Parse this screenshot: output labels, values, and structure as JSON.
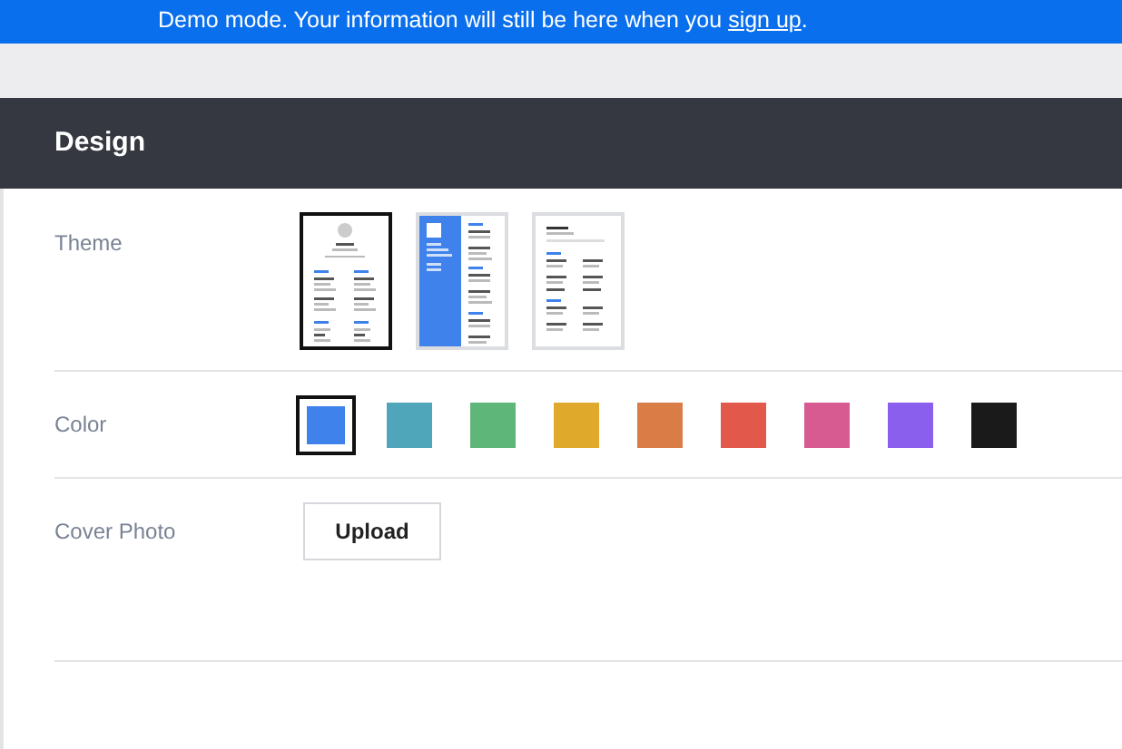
{
  "banner": {
    "message": "Demo mode. Your information will still be here when you",
    "link": "sign up",
    "end": "."
  },
  "section": {
    "title": "Design"
  },
  "theme": {
    "label": "Theme",
    "options": [
      {
        "kind": "centered",
        "selected": true
      },
      {
        "kind": "sidebar",
        "selected": false
      },
      {
        "kind": "classic",
        "selected": false
      }
    ]
  },
  "color": {
    "label": "Color",
    "swatches": [
      {
        "color": "#3f82ec",
        "selected": true
      },
      {
        "color": "#4fa5ba",
        "selected": false
      },
      {
        "color": "#5fb679",
        "selected": false
      },
      {
        "color": "#dfaa2c",
        "selected": false
      },
      {
        "color": "#da7c45",
        "selected": false
      },
      {
        "color": "#e2584b",
        "selected": false
      },
      {
        "color": "#d75a91",
        "selected": false
      },
      {
        "color": "#8a5fed",
        "selected": false
      },
      {
        "color": "#1a1a1a",
        "selected": false
      }
    ]
  },
  "cover_photo": {
    "label": "Cover Photo",
    "button": "Upload"
  }
}
